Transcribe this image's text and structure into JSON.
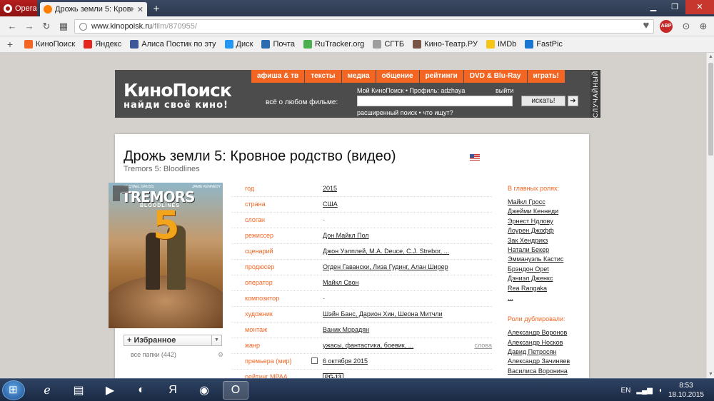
{
  "browser": {
    "menu_label": "Opera",
    "tab_title": "Дрожь земли 5: Кровное",
    "url_host": "www.kinopoisk.ru",
    "url_path": "/film/870955/",
    "abp_label": "ABP"
  },
  "bookmarks": [
    {
      "label": "КиноПоиск",
      "color": "#f26522"
    },
    {
      "label": "Яндекс",
      "color": "#e52620"
    },
    {
      "label": "Алиса Постик по эту",
      "color": "#3b5998"
    },
    {
      "label": "Диск",
      "color": "#2196f3"
    },
    {
      "label": "Почта",
      "color": "#2b6cb0"
    },
    {
      "label": "RuTracker.org",
      "color": "#4caf50"
    },
    {
      "label": "СГТБ",
      "color": "#9e9e9e"
    },
    {
      "label": "Кино-Театр.РУ",
      "color": "#795548"
    },
    {
      "label": "IMDb",
      "color": "#f5c518"
    },
    {
      "label": "FastPic",
      "color": "#1976d2"
    }
  ],
  "kp": {
    "logo": "КиноПоиск",
    "tagline": "найди своё кино!",
    "menu": [
      "афиша & тв",
      "тексты",
      "медиа",
      "общение",
      "рейтинги",
      "DVD & Blu-Ray",
      "играть!"
    ],
    "about_label": "всё о любом фильме:",
    "profile": "Мой КиноПоиск • Профиль: adzhaya",
    "exit": "выйти",
    "search_btn": "искать!",
    "advanced": "расширенный поиск • что ищут?",
    "random": "СЛУЧАЙНЫЙ"
  },
  "film": {
    "title": "Дрожь земли 5: Кровное родство (видео)",
    "original_title": "Tremors 5: Bloodlines",
    "poster": {
      "actor1": "MICHAEL GROSS",
      "actor2": "JAMIE KENNEDY",
      "title": "TREMORS",
      "subtitle": "BLOODLINES",
      "number": "5"
    },
    "favorites_label": "Избранное",
    "folders_label": "все папки (442)",
    "info": [
      {
        "key": "год",
        "value": "2015",
        "link": true
      },
      {
        "key": "страна",
        "value": "США",
        "link": true
      },
      {
        "key": "слоган",
        "value": "-",
        "link": false
      },
      {
        "key": "режиссер",
        "value": "Дон Майкл Пол",
        "link": true
      },
      {
        "key": "сценарий",
        "value": "Джон Уэлплей, M.A. Deuce, C.J. Strebor, ...",
        "link": true
      },
      {
        "key": "продюсер",
        "value": "Огден Гавански, Лиза Гудинг, Алан Ширер",
        "link": true
      },
      {
        "key": "оператор",
        "value": "Майкл Свон",
        "link": true
      },
      {
        "key": "композитор",
        "value": "-",
        "link": false
      },
      {
        "key": "художник",
        "value": "Шэйн Банс, Дарион Хин, Шеона Митчли",
        "link": true
      },
      {
        "key": "монтаж",
        "value": "Ваник Морадян",
        "link": true
      },
      {
        "key": "жанр",
        "value": "ужасы, фантастика, боевик, ...",
        "link": true,
        "extra": "слова"
      },
      {
        "key": "премьера (мир)",
        "value": "6 октября 2015",
        "link": true,
        "calendar": true
      },
      {
        "key": "рейтинг MPAA",
        "value": "PG-13",
        "link": false,
        "badge": true
      }
    ],
    "cast_heading": "В главных ролях:",
    "cast": [
      "Майкл Гросс",
      "Джейми Кеннеди",
      "Эрнест Ндлову",
      "Лоурен Джофф",
      "Зак Хендрикз",
      "Натали Бекер",
      "Эммануэль Кастис",
      "Брэндон Ореt",
      "Дэниэл Дженкс",
      "Rea Rangaka",
      "..."
    ],
    "dub_heading": "Роли дублировали:",
    "dub": [
      "Александр Воронов",
      "Александр Носков",
      "Давид Петросян",
      "Александр Зачиняев",
      "Василиса Воронина"
    ]
  },
  "taskbar": {
    "lang": "EN",
    "time": "8:53",
    "date": "18.10.2015"
  }
}
